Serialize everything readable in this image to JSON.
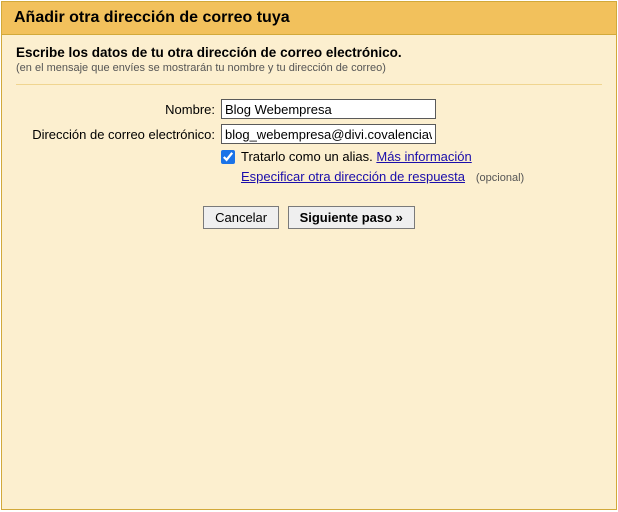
{
  "title": "Añadir otra dirección de correo tuya",
  "intro": "Escribe los datos de tu otra dirección de correo electrónico.",
  "intro_sub": "(en el mensaje que envíes se mostrarán tu nombre y tu dirección de correo)",
  "form": {
    "name_label": "Nombre:",
    "name_value": "Blog Webempresa",
    "email_label": "Dirección de correo electrónico:",
    "email_value": "blog_webempresa@divi.covalenciawebs"
  },
  "alias": {
    "text": "Tratarlo como un alias.",
    "more_info": "Más información"
  },
  "reply": {
    "link": "Especificar otra dirección de respuesta",
    "optional": "(opcional)"
  },
  "buttons": {
    "cancel": "Cancelar",
    "next": "Siguiente paso »"
  }
}
